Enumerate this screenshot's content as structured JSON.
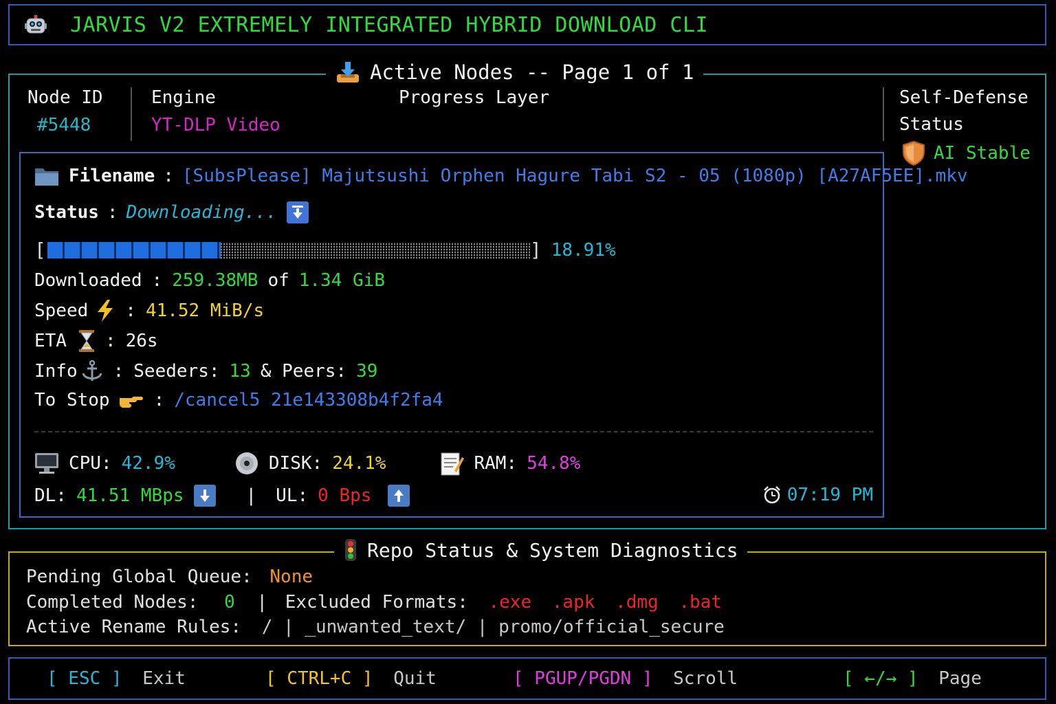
{
  "header": {
    "title": "JARVIS V2 EXTREMELY INTEGRATED HYBRID DOWNLOAD CLI",
    "icon": "robot-icon"
  },
  "nodes_panel": {
    "title": "Active Nodes -- Page 1 of 1",
    "columns": {
      "node_id": "Node ID",
      "engine": "Engine",
      "progress": "Progress Layer",
      "defense_line1": "Self-Defense",
      "defense_line2": "Status"
    },
    "node_id_value": "#5448",
    "engine_value": "YT-DLP Video",
    "defense_value": "AI Stable",
    "details": {
      "filename_label": "Filename",
      "filename_value": "[SubsPlease] Majutsushi Orphen Hagure Tabi S2 - 05 (1080p) [A27AF5EE].mkv",
      "status_label": "Status",
      "status_value": "Downloading...",
      "progress_percent": "18.91%",
      "progress_fraction": 0.1891,
      "downloaded_label": "Downloaded",
      "downloaded_value": "259.38MB",
      "of_text": "of",
      "total_value": "1.34 GiB",
      "speed_label": "Speed",
      "speed_value": "41.52 MiB/s",
      "eta_label": "ETA",
      "eta_value": "26s",
      "info_label": "Info",
      "seeders_label": "Seeders:",
      "seeders_value": "13",
      "peers_label": "& Peers:",
      "peers_value": "39",
      "stop_label": "To Stop",
      "stop_value": "/cancel5 21e143308b4f2fa4",
      "separator": ":"
    },
    "system": {
      "cpu_label": "CPU:",
      "cpu_value": "42.9%",
      "disk_label": "DISK:",
      "disk_value": "24.1%",
      "ram_label": "RAM:",
      "ram_value": "54.8%",
      "dl_label": "DL:",
      "dl_value": "41.51 MBps",
      "pipe": "|",
      "ul_label": "UL:",
      "ul_value": "0 Bps",
      "time": "07:19 PM"
    }
  },
  "repo_panel": {
    "title": "Repo Status & System Diagnostics",
    "pending_label": "Pending Global Queue:",
    "pending_value": "None",
    "completed_label": "Completed Nodes:",
    "completed_value": "0",
    "pipe": "|",
    "excluded_label": "Excluded Formats:",
    "excluded_formats": [
      ".exe",
      ".apk",
      ".dmg",
      ".bat"
    ],
    "rename_label": "Active Rename Rules:",
    "rename_rules": "/ | _unwanted_text/ | promo/official_secure"
  },
  "footer": {
    "keys": [
      {
        "key": "[ ESC ]",
        "action": "Exit",
        "color": "#22b8d8"
      },
      {
        "key": "[ CTRL+C ]",
        "action": "Quit",
        "color": "#f2c622"
      },
      {
        "key": "[ PGUP/PGDN ]",
        "action": "Scroll",
        "color": "#e23ce0"
      },
      {
        "key": "[ ←/→ ]",
        "action": "Page",
        "color": "#2fdc3c"
      }
    ]
  }
}
